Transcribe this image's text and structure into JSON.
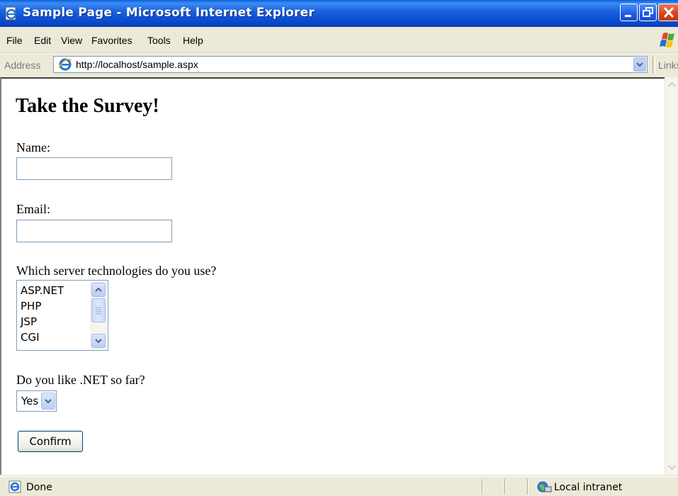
{
  "window": {
    "title": "Sample Page - Microsoft Internet Explorer"
  },
  "menu": [
    "File",
    "Edit",
    "View",
    "Favorites",
    "Tools",
    "Help"
  ],
  "address": {
    "label": "Address",
    "url": "http://localhost/sample.aspx",
    "links_label": "Links"
  },
  "page": {
    "heading": "Take the Survey!",
    "name_label": "Name:",
    "name_value": "",
    "email_label": "Email:",
    "email_value": "",
    "tech_label": "Which server technologies do you use?",
    "tech_options": [
      "ASP.NET",
      "PHP",
      "JSP",
      "CGI"
    ],
    "like_label": "Do you like .NET so far?",
    "like_selected": "Yes",
    "confirm_label": "Confirm"
  },
  "status": {
    "text": "Done",
    "zone": "Local intranet"
  },
  "colors": {
    "titlebar": "#0a4dd0",
    "chrome": "#ece9d8",
    "field_border": "#7f9db9",
    "close_button": "#d4451c"
  }
}
